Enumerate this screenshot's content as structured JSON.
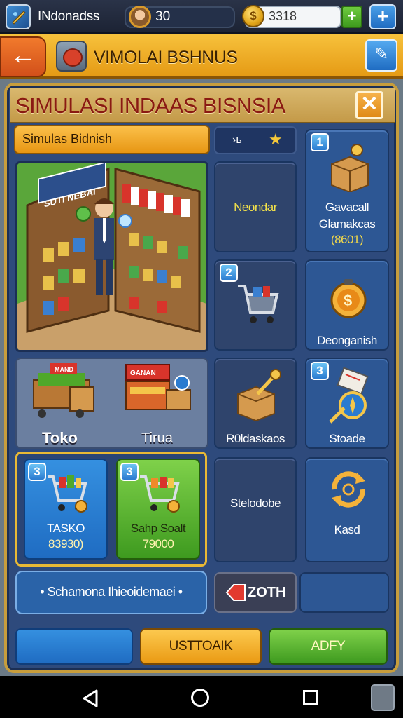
{
  "status_bar": {
    "app_name": "INdonadss",
    "level": "30",
    "coins_value": "3318",
    "coin_symbol": "$",
    "add_coin_label": "+",
    "plus_label": "+"
  },
  "header": {
    "back_label": "←",
    "title": "VIMOLAI BSHNUS",
    "pin_label": "✎"
  },
  "panel": {
    "title": "SIMULASI INDAAS BISNSIA",
    "close_label": "✕",
    "sub_button": "Simulas Bidnish",
    "star_code": "›ь",
    "star_icon": "★"
  },
  "scene": {
    "sign": "SUTI NEBAI"
  },
  "tiles": {
    "neondar": "Neondar",
    "gavacall_line1": "Gavacall",
    "gavacall_line2": "Glamakcas",
    "gavacall_price": "(8601)",
    "gavacall_badge": "1",
    "cart_badge": "2",
    "deonganish": "Deonganish",
    "roldaskaos": "R0ldaskaos",
    "stoade": "Stoade",
    "stoade_badge": "3",
    "stelodobe": "Stelodobe",
    "kasd": "Kasd"
  },
  "shops": {
    "toko": "Toko",
    "tirua": "Tirua",
    "sign1": "MAND",
    "sign2": "GANAN"
  },
  "products": [
    {
      "badge": "3",
      "name": "TASKO",
      "price": "83930)"
    },
    {
      "badge": "3",
      "name": "Sahp Soalt",
      "price": "79000"
    }
  ],
  "info_bar": "• Schamona Ihieoidemaei •",
  "total_button": "ZOTH",
  "bottom_buttons": {
    "left": "",
    "middle": "USTTOAIK",
    "right": "ADFY"
  },
  "colors": {
    "gold_header": "#f2b630",
    "panel_blue": "#2e4a7c",
    "accent_orange": "#e79613",
    "accent_green": "#4fa82a",
    "title_red": "#8a1a12"
  },
  "icons": [
    "app-icon",
    "avatar-icon",
    "coin-icon",
    "add-icon",
    "plus-icon",
    "back-icon",
    "toolbox-icon",
    "pin-icon",
    "close-icon",
    "star-icon",
    "box-icon",
    "cart-icon",
    "coin-lock-icon",
    "package-key-icon",
    "compass-icon",
    "cycle-icon",
    "tag-icon",
    "nav-back-icon",
    "nav-home-icon",
    "nav-recents-icon",
    "bag-icon"
  ]
}
